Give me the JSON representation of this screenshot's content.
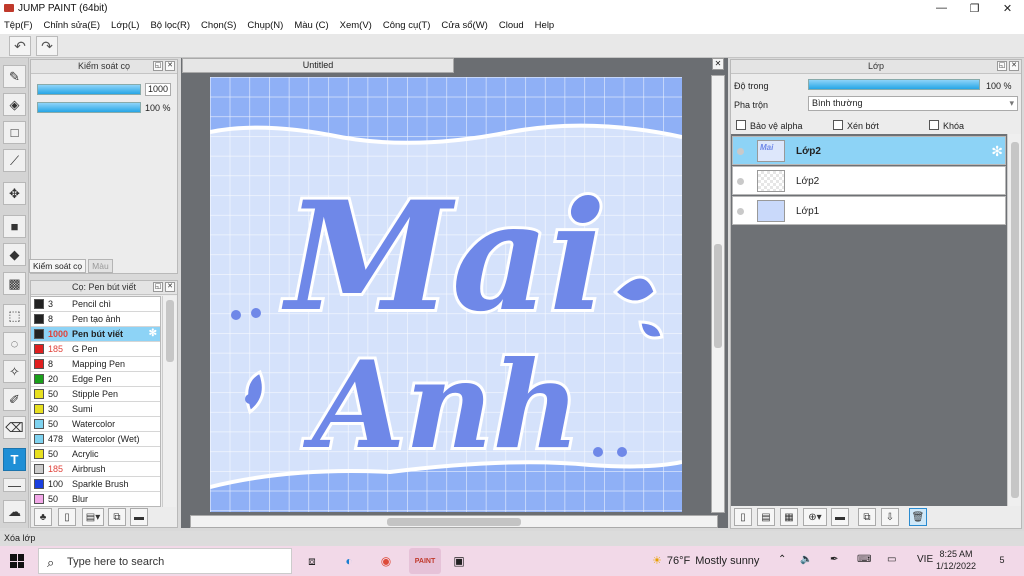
{
  "window": {
    "title": "JUMP PAINT (64bit)",
    "controls": {
      "minimize": "—",
      "maximize": "❐",
      "close": "✕"
    }
  },
  "menu": [
    "Tệp(F)",
    "Chỉnh sửa(E)",
    "Lớp(L)",
    "Bộ lọc(R)",
    "Chọn(S)",
    "Chụp(N)",
    "Màu (C)",
    "Xem(V)",
    "Công cụ(T)",
    "Cửa sổ(W)",
    "Cloud",
    "Help"
  ],
  "toolbar": {
    "undo_icon": "undo-icon",
    "redo_icon": "redo-icon"
  },
  "brush_control": {
    "title": "Kiểm soát cọ",
    "size_value": "1000",
    "opacity_value": "100 %",
    "tab_active": "Kiểm soát cọ",
    "tab_inactive": "Màu"
  },
  "brush_panel": {
    "title": "Cọ: Pen bút viết",
    "brushes": [
      {
        "size": "3",
        "name": "Pencil chì",
        "color": "#222222"
      },
      {
        "size": "8",
        "name": "Pen tạo ảnh",
        "color": "#222222"
      },
      {
        "size": "1000",
        "name": "Pen bút viết",
        "color": "#222222",
        "selected": true
      },
      {
        "size": "185",
        "name": "G Pen",
        "color": "#e02020",
        "red": true
      },
      {
        "size": "8",
        "name": "Mapping Pen",
        "color": "#e02020"
      },
      {
        "size": "20",
        "name": "Edge Pen",
        "color": "#1aa01a"
      },
      {
        "size": "50",
        "name": "Stipple Pen",
        "color": "#e8e020"
      },
      {
        "size": "30",
        "name": "Sumi",
        "color": "#e8e020"
      },
      {
        "size": "50",
        "name": "Watercolor",
        "color": "#7fd3f0"
      },
      {
        "size": "478",
        "name": "Watercolor (Wet)",
        "color": "#7fd3f0"
      },
      {
        "size": "50",
        "name": "Acrylic",
        "color": "#e8e020"
      },
      {
        "size": "185",
        "name": "Airbrush",
        "color": "#cccccc",
        "red": true
      },
      {
        "size": "100",
        "name": "Sparkle Brush",
        "color": "#1a3fe0"
      },
      {
        "size": "50",
        "name": "Blur",
        "color": "#f2a8e8"
      }
    ]
  },
  "document": {
    "tab_title": "Untitled",
    "close": "✕"
  },
  "canvas_text": {
    "line1": "Mai",
    "line2": "Anh"
  },
  "layers_panel": {
    "title": "Lớp",
    "opacity_label": "Độ trong",
    "opacity_value": "100 %",
    "blend_label": "Pha trộn",
    "blend_value": "Bình thường",
    "protect_alpha": "Bảo vệ alpha",
    "clipping": "Xén bớt",
    "lock": "Khóa",
    "layers": [
      {
        "name": "Lớp2",
        "selected": true
      },
      {
        "name": "Lớp2"
      },
      {
        "name": "Lớp1"
      }
    ]
  },
  "status": {
    "text": "Xóa lớp"
  },
  "taskbar": {
    "search_placeholder": "Type here to search",
    "weather_temp": "76°F",
    "weather_desc": "Mostly sunny",
    "lang": "VIE",
    "time": "8:25 AM",
    "date": "1/12/2022",
    "notif_count": "5"
  },
  "colors": {
    "accent": "#26a6e6",
    "selection": "#8dd3f6",
    "lettering": "#6f88e8",
    "grid": "#c8d8f8"
  }
}
